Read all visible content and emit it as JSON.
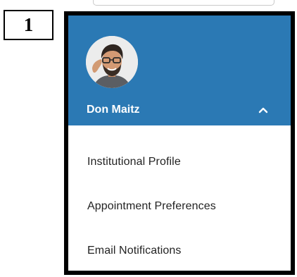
{
  "step_badge": {
    "number": "1"
  },
  "profile_menu": {
    "user_name": "Don Maitz",
    "toggle_icon": "chevron-up-icon",
    "avatar_icon": "user-photo",
    "header_color": "#2b79b4",
    "items": [
      {
        "label": "Institutional Profile"
      },
      {
        "label": "Appointment Preferences"
      },
      {
        "label": "Email Notifications"
      }
    ]
  }
}
